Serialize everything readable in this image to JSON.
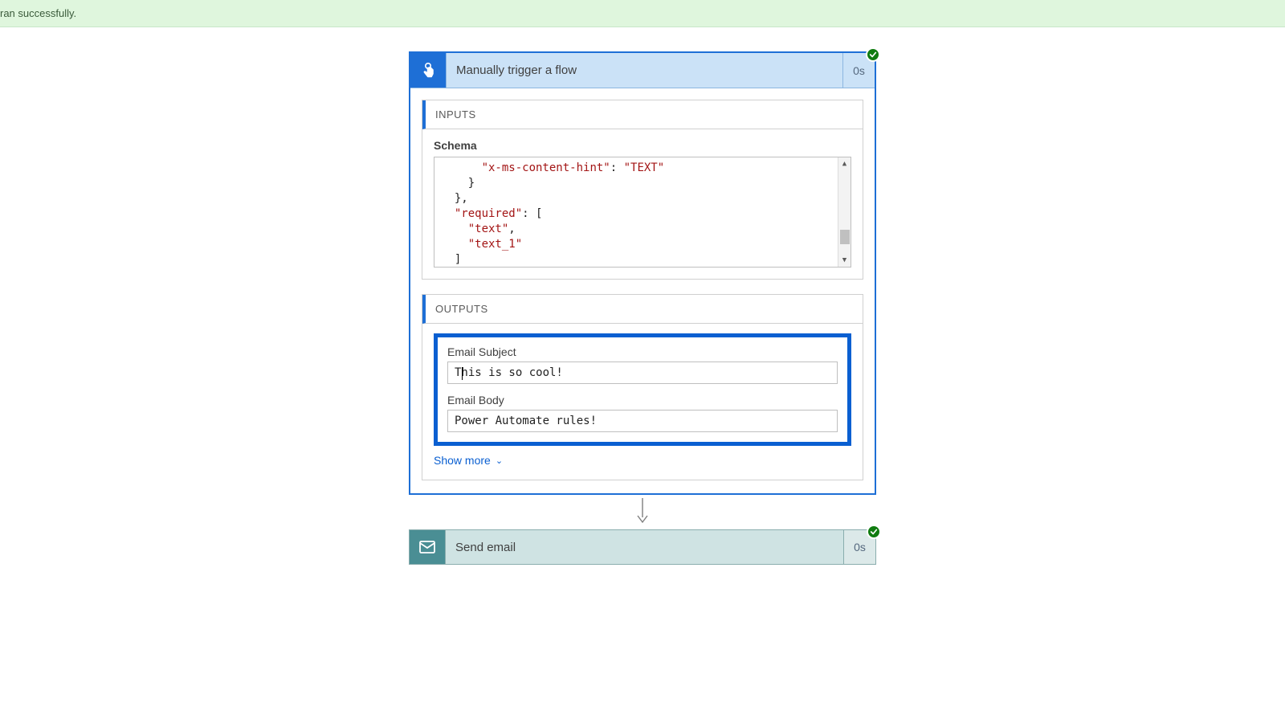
{
  "banner": {
    "text": "ran successfully."
  },
  "trigger": {
    "title": "Manually trigger a flow",
    "duration": "0s",
    "inputs_header": "INPUTS",
    "schema_label": "Schema",
    "schema_lines": {
      "l1_indent": "      ",
      "l1_key": "\"x-ms-content-hint\"",
      "l1_sep": ": ",
      "l1_val": "\"TEXT\"",
      "l2": "    }",
      "l3": "  },",
      "l4_indent": "  ",
      "l4_key": "\"required\"",
      "l4_sep": ": [",
      "l5_indent": "    ",
      "l5_val": "\"text\"",
      "l5_comma": ",",
      "l6_indent": "    ",
      "l6_val": "\"text_1\"",
      "l7": "  ]",
      "l8": "}"
    },
    "outputs_header": "OUTPUTS",
    "outputs": [
      {
        "label": "Email Subject",
        "value": "This is so cool!"
      },
      {
        "label": "Email Body",
        "value": "Power Automate rules!"
      }
    ],
    "show_more": "Show more"
  },
  "action": {
    "title": "Send email",
    "duration": "0s"
  }
}
